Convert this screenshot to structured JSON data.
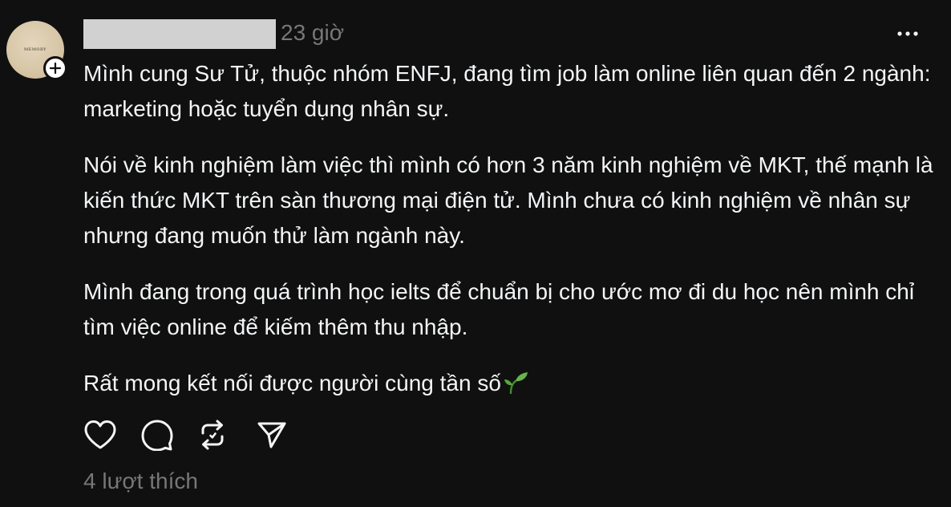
{
  "post": {
    "timestamp": "23 giờ",
    "paragraphs": [
      "Mình cung Sư Tử, thuộc nhóm ENFJ, đang tìm job làm online liên quan đến 2 ngành: marketing hoặc tuyển dụng nhân sự.",
      "Nói về kinh nghiệm làm việc thì mình có hơn 3 năm kinh nghiệm về MKT, thế mạnh là kiến thức MKT trên sàn thương mại điện tử. Mình chưa có kinh nghiệm về nhân sự nhưng đang muốn thử làm ngành này.",
      "Mình đang trong quá trình học ielts để chuẩn bị cho ước mơ đi du học nên mình chỉ tìm việc online để kiếm thêm thu nhập.",
      "Rất mong kết nối được người cùng tần số"
    ],
    "trailing_emoji_icon": "seedling-icon",
    "likes_label": "4 lượt thích"
  },
  "avatar": {
    "mark_text": "MEMORY"
  },
  "icons": {
    "more": "more-horizontal-icon",
    "follow": "plus-icon",
    "like": "heart-icon",
    "comment": "comment-icon",
    "repost": "repost-icon",
    "share": "send-icon"
  },
  "colors": {
    "background": "#101010",
    "text": "#f3f5f7",
    "secondary_text": "#777777",
    "redaction": "#d1d1d1"
  }
}
